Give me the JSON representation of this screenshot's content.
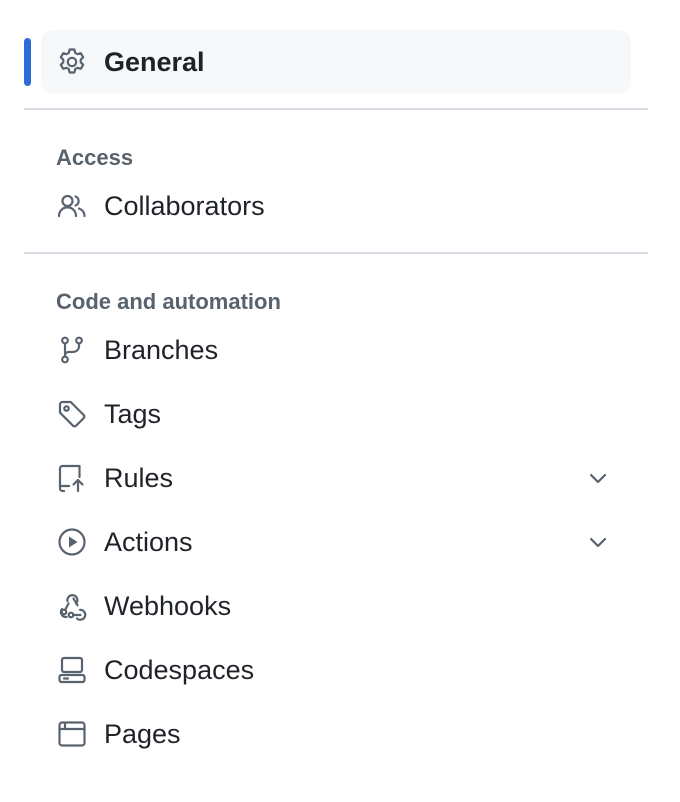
{
  "nav": {
    "general": {
      "label": "General",
      "icon": "gear-icon",
      "active": true
    },
    "sections": [
      {
        "title": "Access",
        "items": [
          {
            "label": "Collaborators",
            "icon": "people-icon",
            "expandable": false
          }
        ]
      },
      {
        "title": "Code and automation",
        "items": [
          {
            "label": "Branches",
            "icon": "git-branch-icon",
            "expandable": false
          },
          {
            "label": "Tags",
            "icon": "tag-icon",
            "expandable": false
          },
          {
            "label": "Rules",
            "icon": "repo-push-icon",
            "expandable": true
          },
          {
            "label": "Actions",
            "icon": "play-icon",
            "expandable": true
          },
          {
            "label": "Webhooks",
            "icon": "webhook-icon",
            "expandable": false
          },
          {
            "label": "Codespaces",
            "icon": "codespaces-icon",
            "expandable": false
          },
          {
            "label": "Pages",
            "icon": "browser-icon",
            "expandable": false
          }
        ]
      }
    ]
  },
  "colors": {
    "active_indicator": "#2f6ad9",
    "active_background": "#f6f8fa",
    "text": "#1f2328",
    "muted": "#59636e",
    "divider": "#d8dee4"
  }
}
